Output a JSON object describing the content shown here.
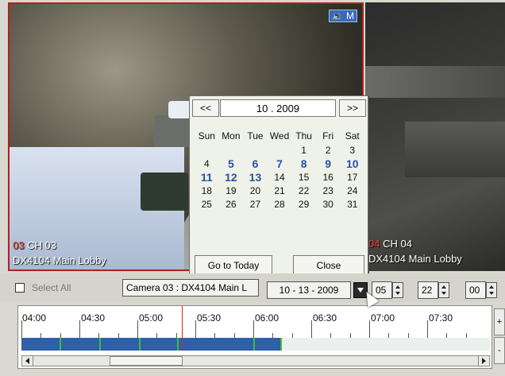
{
  "cameras": [
    {
      "number": "03",
      "channel": "CH 03",
      "name": "DX4104 Main Lobby"
    },
    {
      "number": "04",
      "channel": "CH 04",
      "name": "DX4104 Main Lobby"
    }
  ],
  "audio_badge": "🔉 M",
  "calendar": {
    "prev_label": "<<",
    "next_label": ">>",
    "month_year": "10 . 2009",
    "weekdays": [
      "Sun",
      "Mon",
      "Tue",
      "Wed",
      "Thu",
      "Fri",
      "Sat"
    ],
    "weeks": [
      [
        "",
        "",
        "",
        "",
        "1",
        "2",
        "3"
      ],
      [
        "4",
        "5",
        "6",
        "7",
        "8",
        "9",
        "10"
      ],
      [
        "11",
        "12",
        "13",
        "14",
        "15",
        "16",
        "17"
      ],
      [
        "18",
        "19",
        "20",
        "21",
        "22",
        "23",
        "24"
      ],
      [
        "25",
        "26",
        "27",
        "28",
        "29",
        "30",
        "31"
      ]
    ],
    "recorded_days": [
      "5",
      "6",
      "7",
      "8",
      "9",
      "10",
      "11",
      "12",
      "13"
    ],
    "go_today_label": "Go to Today",
    "close_label": "Close"
  },
  "controls": {
    "select_all_label": "Select All",
    "camera_select": "Camera 03 : DX4104 Main L",
    "date_value": "10 - 13 - 2009",
    "hour": "05",
    "minute": "22",
    "second": "00"
  },
  "timeline": {
    "labels": [
      "04:00",
      "04:30",
      "05:00",
      "05:30",
      "06:00",
      "06:30",
      "07:00",
      "07:30"
    ],
    "zoom_in_label": "+",
    "zoom_out_label": "-"
  },
  "colors": {
    "recorded_day": "#2a4fa6",
    "camera_number": "#ff3a3a",
    "recording_segment": "#2f5fa8",
    "event_marker": "#3cbc3c",
    "playhead": "#e02020"
  }
}
